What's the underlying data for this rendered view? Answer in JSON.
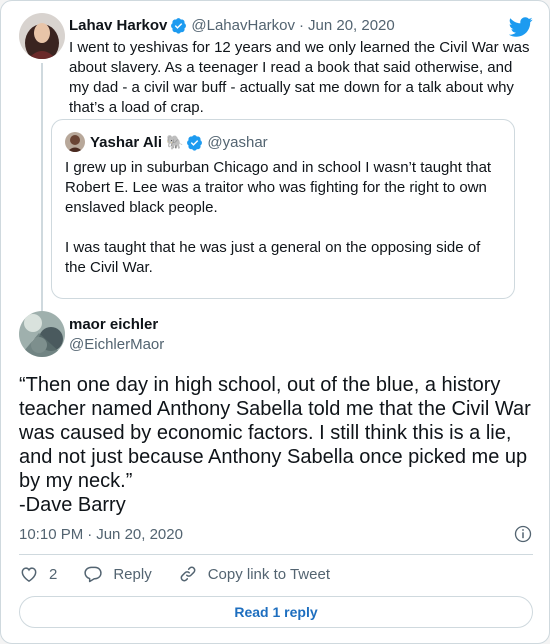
{
  "parent": {
    "name": "Lahav Harkov",
    "handle": "@LahavHarkov",
    "separator": "·",
    "date": "Jun 20, 2020",
    "text": "I went to yeshivas for 12 years and we only learned the Civil War was\nabout slavery. As a teenager I read a book that said otherwise, and\nmy dad - a civil war buff - actually sat me down for a talk about why\nthat’s a load of crap.",
    "verified": true
  },
  "quote": {
    "name": "Yashar Ali",
    "emoji": "🐘",
    "handle": "@yashar",
    "verified": true,
    "text": "I grew up in suburban Chicago and in school I wasn’t taught that\nRobert E. Lee was a traitor who was fighting for the right to own\nenslaved black people.\n\nI was taught that he was just a general on the opposing side of\nthe Civil War."
  },
  "main": {
    "name": "maor eichler",
    "handle": "@EichlerMaor",
    "text": "“Then one day in high school, out of the blue, a history\nteacher named Anthony Sabella told me that the Civil War\nwas caused by economic factors. I still think this is a lie,\nand not just because Anthony Sabella once picked me up\nby my neck.”\n-Dave Barry",
    "time": "10:10 PM",
    "separator": "·",
    "date": "Jun 20, 2020"
  },
  "actions": {
    "like_count": "2",
    "reply_label": "Reply",
    "copy_label": "Copy link to Tweet"
  },
  "read_button": "Read 1 reply",
  "colors": {
    "twitter_blue": "#1d9bf0",
    "link_blue": "#1d6ebf",
    "text_secondary": "#536471",
    "border": "#cfd9de"
  },
  "icons": [
    "verified-badge-icon",
    "twitter-bird-icon",
    "info-icon",
    "heart-icon",
    "reply-bubble-icon",
    "link-icon"
  ]
}
